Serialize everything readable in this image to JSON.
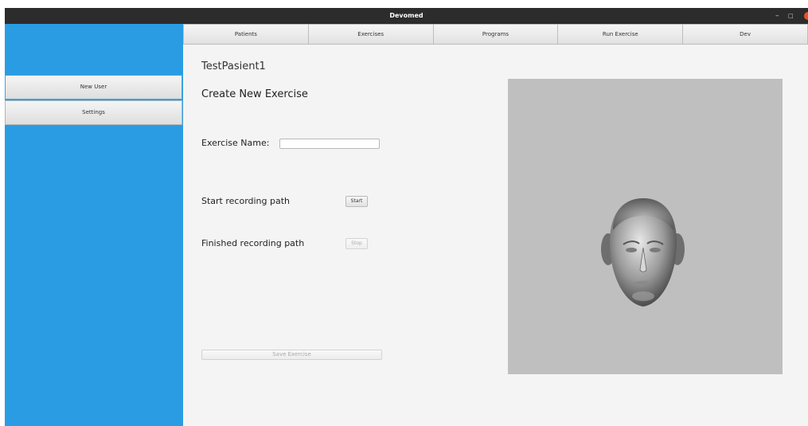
{
  "window": {
    "title": "Devomed",
    "controls": {
      "minimize": "–",
      "maximize": "□"
    }
  },
  "sidebar": {
    "items": [
      {
        "label": "New User"
      },
      {
        "label": "Settings"
      }
    ]
  },
  "tabs": [
    {
      "label": "Patients"
    },
    {
      "label": "Exercises"
    },
    {
      "label": "Programs"
    },
    {
      "label": "Run Exercise"
    },
    {
      "label": "Dev"
    }
  ],
  "main": {
    "patient_name": "TestPasient1",
    "heading": "Create New Exercise",
    "exercise_name_label": "Exercise Name:",
    "exercise_name_value": "",
    "start_label": "Start recording path",
    "start_button": "Start",
    "finish_label": "Finished recording path",
    "stop_button": "Stop",
    "save_button": "Save Exercise"
  },
  "viewport": {
    "content": "3d-face-model"
  },
  "colors": {
    "sidebar": "#2a9ce3",
    "titlebar": "#2c2c2c",
    "close": "#e95420",
    "viewport": "#bfbfbf"
  }
}
